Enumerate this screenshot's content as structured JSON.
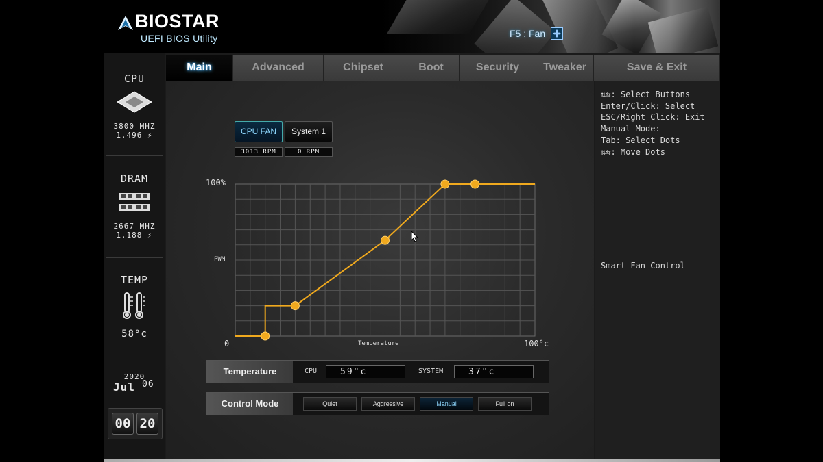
{
  "header": {
    "brand": "BIOSTAR",
    "subtitle": "UEFI BIOS Utility",
    "fan_hint": "F5 : Fan",
    "fan_hint_icon": "fan-icon"
  },
  "tabs": [
    {
      "label": "Main",
      "active": true
    },
    {
      "label": "Advanced",
      "active": false
    },
    {
      "label": "Chipset",
      "active": false
    },
    {
      "label": "Boot",
      "active": false
    },
    {
      "label": "Security",
      "active": false
    },
    {
      "label": "Tweaker",
      "active": false
    },
    {
      "label": "Save & Exit",
      "active": false
    }
  ],
  "sidebar": {
    "cpu": {
      "title": "CPU",
      "freq": "3800 MHZ",
      "volt": "1.496 ⚡",
      "icon": "cpu-chip-icon"
    },
    "dram": {
      "title": "DRAM",
      "freq": "2667 MHZ",
      "volt": "1.188 ⚡",
      "icon": "memory-module-icon"
    },
    "temp": {
      "title": "TEMP",
      "value": "58°c",
      "icon": "thermometer-icon"
    },
    "date": {
      "year": "2020",
      "month": "Jul",
      "day": "06"
    },
    "clock": {
      "hh": "00",
      "mm": "20"
    }
  },
  "fans": {
    "buttons": [
      {
        "label": "CPU FAN",
        "selected": true,
        "rpm": "3013 RPM"
      },
      {
        "label": "System 1",
        "selected": false,
        "rpm": "0 RPM"
      }
    ]
  },
  "chart_data": {
    "type": "line",
    "ymax_label": "100%",
    "ylabel": "PWM",
    "xmin_label": "0",
    "xmax_label": "100°c",
    "xlabel": "Temperature",
    "xlim": [
      0,
      100
    ],
    "ylim": [
      0,
      100
    ],
    "line_color": "#f0a91e",
    "control_points": [
      {
        "x": 10,
        "y": 0
      },
      {
        "x": 20,
        "y": 20
      },
      {
        "x": 50,
        "y": 63
      },
      {
        "x": 70,
        "y": 100
      },
      {
        "x": 80,
        "y": 100
      }
    ],
    "line_path": [
      {
        "x": 0,
        "y": 0
      },
      {
        "x": 10,
        "y": 0
      },
      {
        "x": 10,
        "y": 20
      },
      {
        "x": 20,
        "y": 20
      },
      {
        "x": 50,
        "y": 63
      },
      {
        "x": 70,
        "y": 100
      },
      {
        "x": 80,
        "y": 100
      },
      {
        "x": 100,
        "y": 100
      }
    ],
    "grid": true
  },
  "temperature_bar": {
    "label": "Temperature",
    "cpu_key": "CPU",
    "cpu_value": "59°c",
    "system_key": "SYSTEM",
    "system_value": "37°c"
  },
  "control_mode": {
    "label": "Control Mode",
    "options": [
      {
        "label": "Quiet",
        "active": false
      },
      {
        "label": "Aggressive",
        "active": false
      },
      {
        "label": "Manual",
        "active": true
      },
      {
        "label": "Full on",
        "active": false
      }
    ]
  },
  "help": {
    "lines": [
      "⇅⇆: Select Buttons",
      "Enter/Click: Select",
      "ESC/Right Click: Exit",
      "Manual Mode:",
      "Tab: Select Dots",
      "⇅⇆: Move Dots"
    ],
    "description": "Smart Fan Control"
  }
}
